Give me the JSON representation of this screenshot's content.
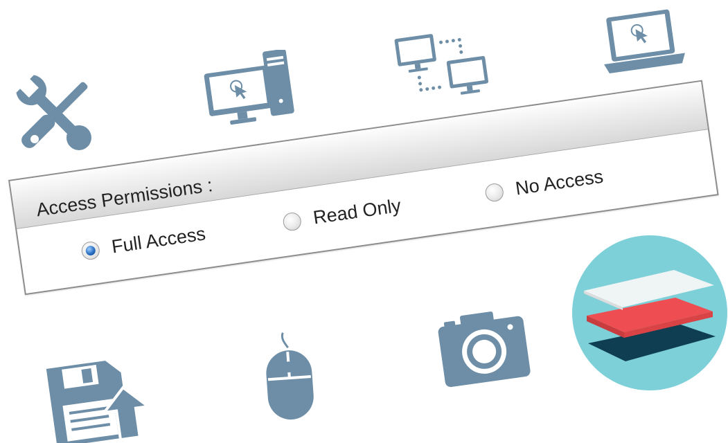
{
  "panel": {
    "title": "Access Permissions :",
    "options": [
      {
        "label": "Full Access",
        "checked": true
      },
      {
        "label": "Read Only",
        "checked": false
      },
      {
        "label": "No Access",
        "checked": false
      }
    ]
  },
  "colors": {
    "icon": "#6d8ea6",
    "teal_circle": "#7dd0d8",
    "layer_top": "#f6f6f6",
    "layer_middle": "#ee4e51",
    "layer_bottom": "#0f3d52",
    "radio_selected": "#2a6fc2"
  },
  "icons": [
    "tools-icon",
    "desktop-computer-icon",
    "network-icon",
    "laptop-icon",
    "floppy-upload-icon",
    "mouse-icon",
    "camera-icon",
    "layers-icon"
  ]
}
